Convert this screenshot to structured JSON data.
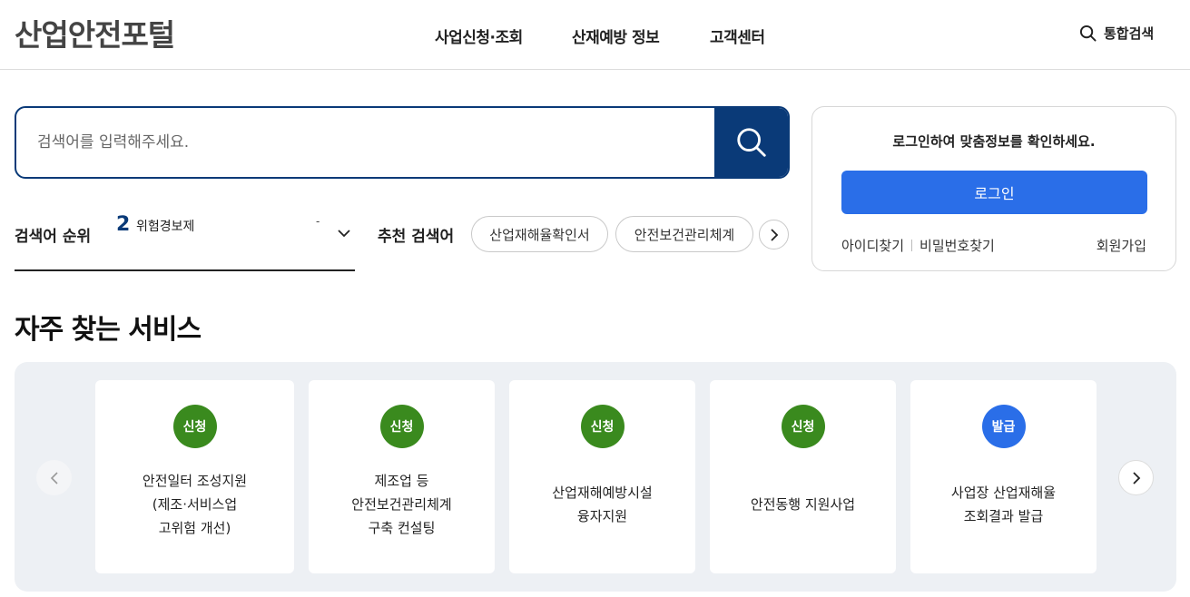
{
  "header": {
    "logo": "산업안전포털",
    "nav": [
      "사업신청·조회",
      "산재예방 정보",
      "고객센터"
    ],
    "integrated_search": "통합검색"
  },
  "search": {
    "placeholder": "검색어를 입력해주세요.",
    "button_icon": "search-icon"
  },
  "ranking": {
    "label": "검색어 순위",
    "rank": "2",
    "keyword": "위험경보제",
    "change": "-"
  },
  "recommended": {
    "label": "추천 검색어",
    "chips": [
      "산업재해율확인서",
      "안전보건관리체계"
    ]
  },
  "login": {
    "message": "로그인하여 맞춤정보를 확인하세요.",
    "button": "로그인",
    "find_id": "아이디찾기",
    "find_pw": "비밀번호찾기",
    "join": "회원가입"
  },
  "services": {
    "title": "자주 찾는 서비스",
    "cards": [
      {
        "badge": "신청",
        "text": "안전일터 조성지원\n(제조·서비스업\n고위험 개선)"
      },
      {
        "badge": "신청",
        "text": "제조업 등\n안전보건관리체계\n구축 컨설팅"
      },
      {
        "badge": "신청",
        "text": "산업재해예방시설\n융자지원"
      },
      {
        "badge": "신청",
        "text": "안전동행 지원사업"
      },
      {
        "badge": "발급",
        "text": "사업장 산업재해율\n조회결과 발급"
      }
    ]
  },
  "colors": {
    "navy": "#0a3a78",
    "login_blue": "#2a6ee8",
    "badge_green": "#3a8a1e",
    "badge_blue": "#2a6ee8"
  }
}
